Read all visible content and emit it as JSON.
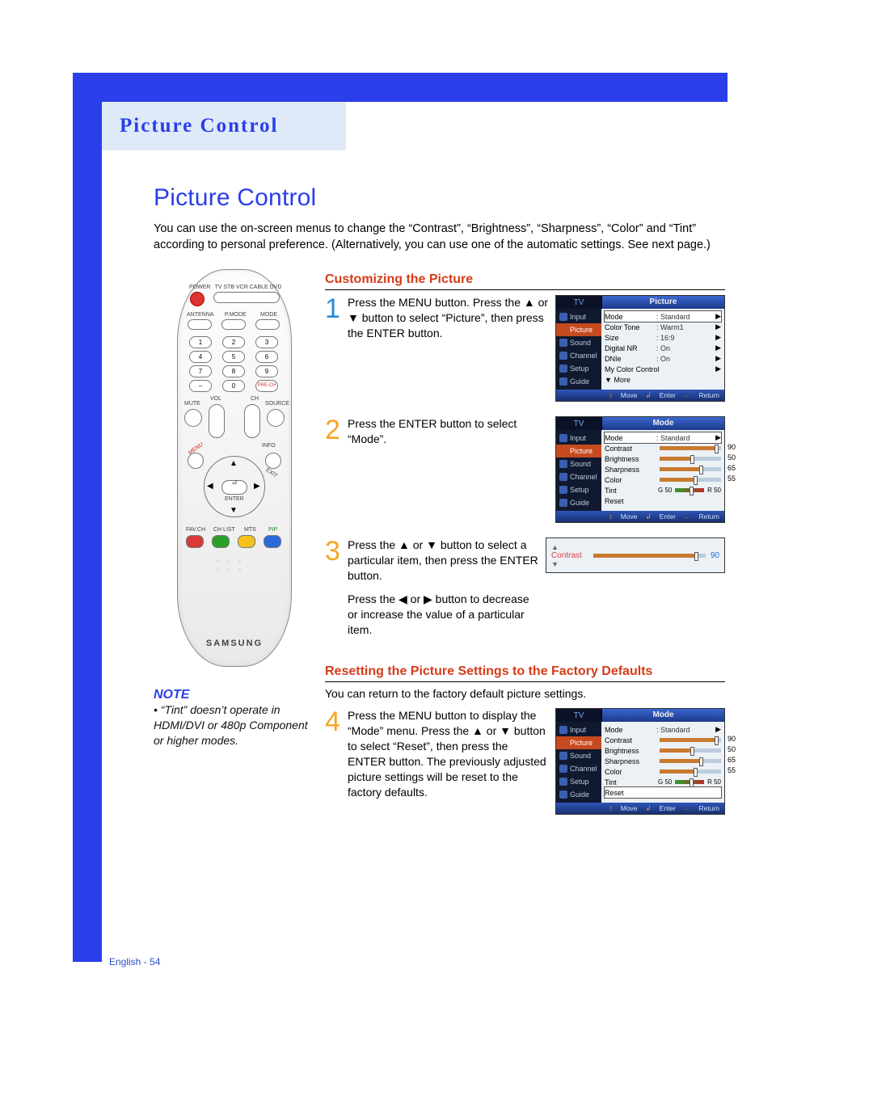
{
  "chapter": "Picture Control",
  "section_title": "Picture Control",
  "intro": "You can use the on-screen menus to change the “Contrast”, “Brightness”, “Sharpness”, “Color” and “Tint” according to personal preference. (Alternatively, you can use one of the automatic settings. See next page.)",
  "subheader1": "Customizing the Picture",
  "steps": {
    "s1": "Press the MENU button. Press the ▲ or ▼ button to select “Picture”, then press the ENTER button.",
    "s2": "Press the ENTER button to select “Mode”.",
    "s3a": "Press the ▲ or ▼ button to select a particular item, then press the ENTER button.",
    "s3b": "Press the ◀ or ▶ button to decrease or increase the value of a particular item.",
    "s4": "Press the MENU button to display the “Mode” menu. Press the ▲ or ▼ button to select “Reset”, then press the ENTER button. The previously adjusted picture settings will be reset to the factory defaults."
  },
  "subheader2": "Resetting the Picture Settings to the Factory Defaults",
  "reset_intro": "You can return to the factory default picture settings.",
  "note": {
    "heading": "NOTE",
    "body": "• “Tint” doesn’t operate in HDMI/DVI or 480p Component or higher modes."
  },
  "osd": {
    "tv_tab": "TV",
    "sidebar": [
      "Input",
      "Picture",
      "Sound",
      "Channel",
      "Setup",
      "Guide"
    ],
    "footer": {
      "move": "Move",
      "enter": "Enter",
      "return": "Return",
      "move_sym": "↕",
      "enter_sym": "↲",
      "return_sym": "←"
    },
    "picture_menu": {
      "title": "Picture",
      "rows": [
        {
          "k": "Mode",
          "v": ": Standard",
          "sel": true
        },
        {
          "k": "Color Tone",
          "v": ": Warm1"
        },
        {
          "k": "Size",
          "v": ": 16:9"
        },
        {
          "k": "Digital NR",
          "v": ": On"
        },
        {
          "k": "DNIe",
          "v": ": On"
        },
        {
          "k": "My Color Control",
          "v": ""
        },
        {
          "k": "▼ More",
          "v": ""
        }
      ]
    },
    "mode_menu": {
      "title": "Mode",
      "mode_row": {
        "k": "Mode",
        "v": ": Standard"
      },
      "sliders": [
        {
          "k": "Contrast",
          "val": 90
        },
        {
          "k": "Brightness",
          "val": 50
        },
        {
          "k": "Sharpness",
          "val": 65
        },
        {
          "k": "Color",
          "val": 55
        }
      ],
      "tint": {
        "k": "Tint",
        "g": "G 50",
        "r": "R 50",
        "val": 50
      },
      "reset": "Reset"
    },
    "contrast_bar": {
      "label": "Contrast",
      "val": 90
    }
  },
  "remote": {
    "brand": "SAMSUNG",
    "labels": {
      "power": "POWER",
      "row1": "TV  STB  VCR  CABLE  DVD",
      "antenna": "ANTENNA",
      "pmode": "P.MODE",
      "mode": "MODE",
      "mute": "MUTE",
      "source": "SOURCE",
      "vol": "VOL",
      "ch": "CH",
      "prech": "PRE-CH",
      "info": "INFO",
      "enter": "ENTER",
      "favch": "FAV.CH",
      "chlist": "CH LIST",
      "mts": "MTS",
      "pip": "PIP",
      "menu": "MENU",
      "exit": "EXIT"
    }
  },
  "footer_page": "English - 54"
}
